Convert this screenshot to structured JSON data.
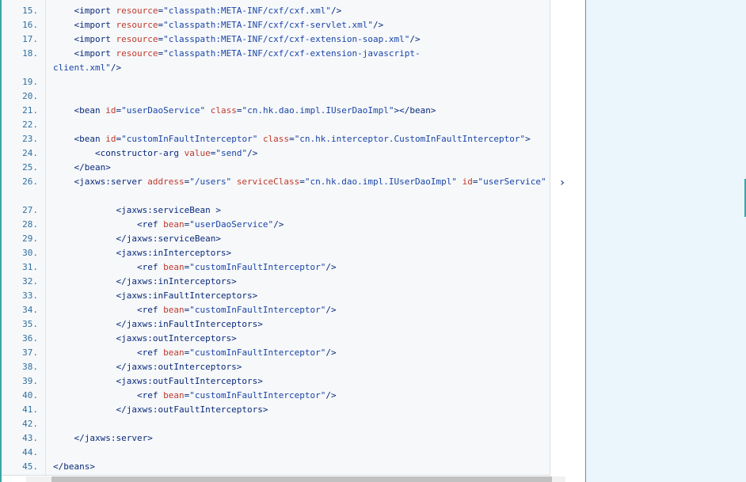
{
  "code_block": {
    "lines": [
      {
        "num": "15.",
        "indent": "    ",
        "tokens": [
          {
            "t": "tag",
            "v": "<import "
          },
          {
            "t": "attr",
            "v": "resource"
          },
          {
            "t": "txt",
            "v": "="
          },
          {
            "t": "str",
            "v": "\"classpath:META-INF/cxf/cxf.xml\""
          },
          {
            "t": "tag",
            "v": "/>"
          }
        ]
      },
      {
        "num": "16.",
        "indent": "    ",
        "tokens": [
          {
            "t": "tag",
            "v": "<import "
          },
          {
            "t": "attr",
            "v": "resource"
          },
          {
            "t": "txt",
            "v": "="
          },
          {
            "t": "str",
            "v": "\"classpath:META-INF/cxf/cxf-servlet.xml\""
          },
          {
            "t": "tag",
            "v": "/>"
          }
        ]
      },
      {
        "num": "17.",
        "indent": "    ",
        "tokens": [
          {
            "t": "tag",
            "v": "<import "
          },
          {
            "t": "attr",
            "v": "resource"
          },
          {
            "t": "txt",
            "v": "="
          },
          {
            "t": "str",
            "v": "\"classpath:META-INF/cxf/cxf-extension-soap.xml\""
          },
          {
            "t": "tag",
            "v": "/>"
          }
        ]
      },
      {
        "num": "18.",
        "indent": "    ",
        "tokens": [
          {
            "t": "tag",
            "v": "<import "
          },
          {
            "t": "attr",
            "v": "resource"
          },
          {
            "t": "txt",
            "v": "="
          },
          {
            "t": "str",
            "v": "\"classpath:META-INF/cxf/cxf-extension-javascript-"
          }
        ]
      },
      {
        "num": "",
        "indent": "",
        "tokens": [
          {
            "t": "str",
            "v": "client.xml\""
          },
          {
            "t": "tag",
            "v": "/>"
          }
        ]
      },
      {
        "num": "19.",
        "indent": "",
        "tokens": []
      },
      {
        "num": "20.",
        "indent": "",
        "tokens": []
      },
      {
        "num": "21.",
        "indent": "    ",
        "tokens": [
          {
            "t": "tag",
            "v": "<bean "
          },
          {
            "t": "attr",
            "v": "id"
          },
          {
            "t": "txt",
            "v": "="
          },
          {
            "t": "str",
            "v": "\"userDaoService\""
          },
          {
            "t": "txt",
            "v": " "
          },
          {
            "t": "attr",
            "v": "class"
          },
          {
            "t": "txt",
            "v": "="
          },
          {
            "t": "str",
            "v": "\"cn.hk.dao.impl.IUserDaoImpl\""
          },
          {
            "t": "tag",
            "v": "></bean>"
          }
        ]
      },
      {
        "num": "22.",
        "indent": "",
        "tokens": []
      },
      {
        "num": "23.",
        "indent": "    ",
        "tokens": [
          {
            "t": "tag",
            "v": "<bean "
          },
          {
            "t": "attr",
            "v": "id"
          },
          {
            "t": "txt",
            "v": "="
          },
          {
            "t": "str",
            "v": "\"customInFaultInterceptor\""
          },
          {
            "t": "txt",
            "v": " "
          },
          {
            "t": "attr",
            "v": "class"
          },
          {
            "t": "txt",
            "v": "="
          },
          {
            "t": "str",
            "v": "\"cn.hk.interceptor.CustomInFaultInterceptor\""
          },
          {
            "t": "tag",
            "v": ">"
          }
        ]
      },
      {
        "num": "24.",
        "indent": "        ",
        "tokens": [
          {
            "t": "tag",
            "v": "<constructor-arg "
          },
          {
            "t": "attr",
            "v": "value"
          },
          {
            "t": "txt",
            "v": "="
          },
          {
            "t": "str",
            "v": "\"send\""
          },
          {
            "t": "tag",
            "v": "/>"
          }
        ]
      },
      {
        "num": "25.",
        "indent": "    ",
        "tokens": [
          {
            "t": "tag",
            "v": "</bean>"
          }
        ]
      },
      {
        "num": "26.",
        "indent": "    ",
        "tokens": [
          {
            "t": "tag",
            "v": "<jaxws:server "
          },
          {
            "t": "attr",
            "v": "address"
          },
          {
            "t": "txt",
            "v": "="
          },
          {
            "t": "str",
            "v": "\"/users\""
          },
          {
            "t": "txt",
            "v": " "
          },
          {
            "t": "attr",
            "v": "serviceClass"
          },
          {
            "t": "txt",
            "v": "="
          },
          {
            "t": "str",
            "v": "\"cn.hk.dao.impl.IUserDaoImpl\""
          },
          {
            "t": "txt",
            "v": " "
          },
          {
            "t": "attr",
            "v": "id"
          },
          {
            "t": "txt",
            "v": "="
          },
          {
            "t": "str",
            "v": "\"userService\""
          }
        ]
      },
      {
        "num": "",
        "indent": "",
        "tokens": []
      },
      {
        "num": "27.",
        "indent": "            ",
        "tokens": [
          {
            "t": "tag",
            "v": "<jaxws:serviceBean >"
          }
        ]
      },
      {
        "num": "28.",
        "indent": "                ",
        "tokens": [
          {
            "t": "tag",
            "v": "<ref "
          },
          {
            "t": "attr",
            "v": "bean"
          },
          {
            "t": "txt",
            "v": "="
          },
          {
            "t": "str",
            "v": "\"userDaoService\""
          },
          {
            "t": "tag",
            "v": "/>"
          }
        ]
      },
      {
        "num": "29.",
        "indent": "            ",
        "tokens": [
          {
            "t": "tag",
            "v": "</jaxws:serviceBean>"
          }
        ]
      },
      {
        "num": "30.",
        "indent": "            ",
        "tokens": [
          {
            "t": "tag",
            "v": "<jaxws:inInterceptors>"
          }
        ]
      },
      {
        "num": "31.",
        "indent": "                ",
        "tokens": [
          {
            "t": "tag",
            "v": "<ref "
          },
          {
            "t": "attr",
            "v": "bean"
          },
          {
            "t": "txt",
            "v": "="
          },
          {
            "t": "str",
            "v": "\"customInFaultInterceptor\""
          },
          {
            "t": "tag",
            "v": "/>"
          }
        ]
      },
      {
        "num": "32.",
        "indent": "            ",
        "tokens": [
          {
            "t": "tag",
            "v": "</jaxws:inInterceptors>"
          }
        ]
      },
      {
        "num": "33.",
        "indent": "            ",
        "tokens": [
          {
            "t": "tag",
            "v": "<jaxws:inFaultInterceptors>"
          }
        ]
      },
      {
        "num": "34.",
        "indent": "                ",
        "tokens": [
          {
            "t": "tag",
            "v": "<ref "
          },
          {
            "t": "attr",
            "v": "bean"
          },
          {
            "t": "txt",
            "v": "="
          },
          {
            "t": "str",
            "v": "\"customInFaultInterceptor\""
          },
          {
            "t": "tag",
            "v": "/>"
          }
        ]
      },
      {
        "num": "35.",
        "indent": "            ",
        "tokens": [
          {
            "t": "tag",
            "v": "</jaxws:inFaultInterceptors>"
          }
        ]
      },
      {
        "num": "36.",
        "indent": "            ",
        "tokens": [
          {
            "t": "tag",
            "v": "<jaxws:outInterceptors>"
          }
        ]
      },
      {
        "num": "37.",
        "indent": "                ",
        "tokens": [
          {
            "t": "tag",
            "v": "<ref "
          },
          {
            "t": "attr",
            "v": "bean"
          },
          {
            "t": "txt",
            "v": "="
          },
          {
            "t": "str",
            "v": "\"customInFaultInterceptor\""
          },
          {
            "t": "tag",
            "v": "/>"
          }
        ]
      },
      {
        "num": "38.",
        "indent": "            ",
        "tokens": [
          {
            "t": "tag",
            "v": "</jaxws:outInterceptors>"
          }
        ]
      },
      {
        "num": "39.",
        "indent": "            ",
        "tokens": [
          {
            "t": "tag",
            "v": "<jaxws:outFaultInterceptors>"
          }
        ]
      },
      {
        "num": "40.",
        "indent": "                ",
        "tokens": [
          {
            "t": "tag",
            "v": "<ref "
          },
          {
            "t": "attr",
            "v": "bean"
          },
          {
            "t": "txt",
            "v": "="
          },
          {
            "t": "str",
            "v": "\"customInFaultInterceptor\""
          },
          {
            "t": "tag",
            "v": "/>"
          }
        ]
      },
      {
        "num": "41.",
        "indent": "            ",
        "tokens": [
          {
            "t": "tag",
            "v": "</jaxws:outFaultInterceptors>"
          }
        ]
      },
      {
        "num": "42.",
        "indent": "",
        "tokens": []
      },
      {
        "num": "43.",
        "indent": "    ",
        "tokens": [
          {
            "t": "tag",
            "v": "</jaxws:server>"
          }
        ]
      },
      {
        "num": "44.",
        "indent": "",
        "tokens": []
      },
      {
        "num": "45.",
        "indent": "",
        "tokens": [
          {
            "t": "tag",
            "v": "</beans>"
          }
        ]
      }
    ]
  },
  "expand_icon": {
    "glyph": "›",
    "name": "chevron-right-icon"
  },
  "colors": {
    "accent_border": "#3aa6a8",
    "right_panel": "#eaf5fc",
    "code_bg": "#f6f8fa"
  }
}
